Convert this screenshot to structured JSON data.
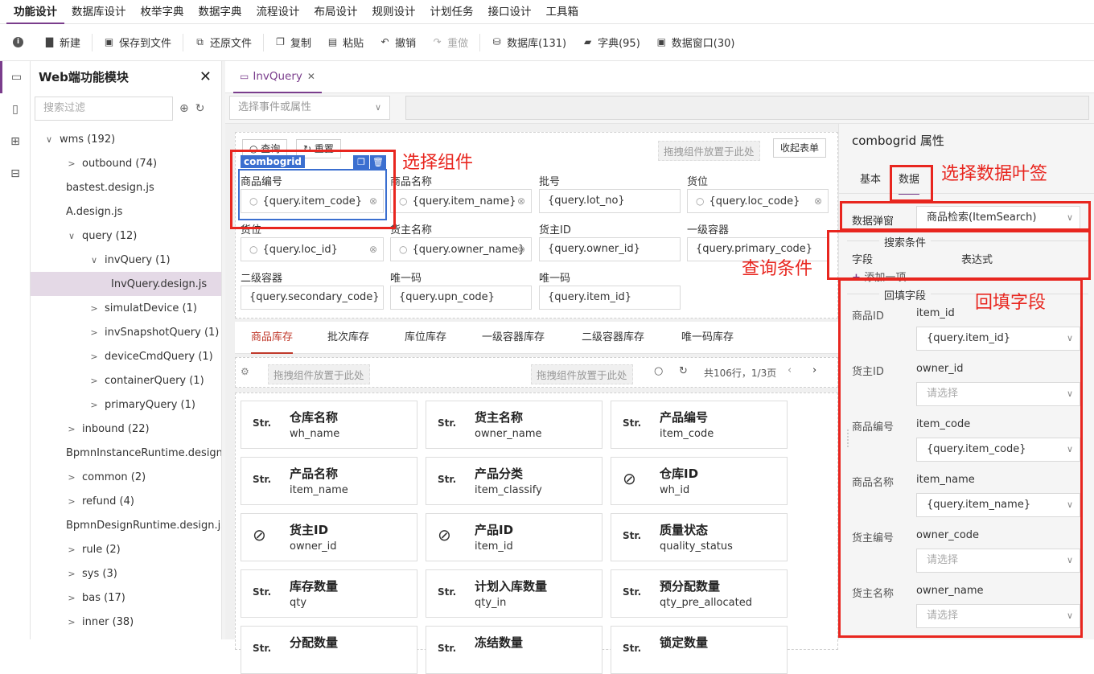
{
  "menu": [
    "功能设计",
    "数据库设计",
    "枚举字典",
    "数据字典",
    "流程设计",
    "布局设计",
    "规则设计",
    "计划任务",
    "接口设计",
    "工具箱"
  ],
  "toolbar": {
    "info": "",
    "new": "新建",
    "save": "保存到文件",
    "restore": "还原文件",
    "copy": "复制",
    "paste": "粘贴",
    "undo": "撤销",
    "redo": "重做",
    "db": "数据库(131)",
    "dict": "字典(95)",
    "window": "数据窗口(30)"
  },
  "tree": {
    "title": "Web端功能模块",
    "search_placeholder": "搜索过滤",
    "items": [
      {
        "label": "wms (192)",
        "level": 1,
        "arrow": "∨"
      },
      {
        "label": "outbound (74)",
        "level": 2,
        "arrow": ">"
      },
      {
        "label": "bastest.design.js",
        "level": 2,
        "arrow": ""
      },
      {
        "label": "A.design.js",
        "level": 2,
        "arrow": ""
      },
      {
        "label": "query (12)",
        "level": 2,
        "arrow": "∨"
      },
      {
        "label": "invQuery (1)",
        "level": 3,
        "arrow": "∨"
      },
      {
        "label": "InvQuery.design.js",
        "level": 4,
        "arrow": "",
        "selected": true
      },
      {
        "label": "simulatDevice (1)",
        "level": 3,
        "arrow": ">"
      },
      {
        "label": "invSnapshotQuery (1)",
        "level": 3,
        "arrow": ">"
      },
      {
        "label": "deviceCmdQuery (1)",
        "level": 3,
        "arrow": ">"
      },
      {
        "label": "containerQuery (1)",
        "level": 3,
        "arrow": ">"
      },
      {
        "label": "primaryQuery (1)",
        "level": 3,
        "arrow": ">"
      },
      {
        "label": "inbound (22)",
        "level": 2,
        "arrow": ">"
      },
      {
        "label": "BpmnInstanceRuntime.design.js",
        "level": 2,
        "arrow": ""
      },
      {
        "label": "common (2)",
        "level": 2,
        "arrow": ">"
      },
      {
        "label": "refund (4)",
        "level": 2,
        "arrow": ">"
      },
      {
        "label": "BpmnDesignRuntime.design.js",
        "level": 2,
        "arrow": ""
      },
      {
        "label": "rule (2)",
        "level": 2,
        "arrow": ">"
      },
      {
        "label": "sys (3)",
        "level": 2,
        "arrow": ">"
      },
      {
        "label": "bas (17)",
        "level": 2,
        "arrow": ">"
      },
      {
        "label": "inner (38)",
        "level": 2,
        "arrow": ">"
      }
    ]
  },
  "editor_tab": "InvQuery",
  "event_select_placeholder": "选择事件或属性",
  "form": {
    "query_btn": "查询",
    "reset_btn": "重置",
    "drop_hint": "拖拽组件放置于此处",
    "collapse_btn": "收起表单",
    "combo_tag": "combogrid",
    "fields": [
      {
        "label": "商品编号",
        "value": "{query.item_code}",
        "search": true
      },
      {
        "label": "商品名称",
        "value": "{query.item_name}",
        "search": true
      },
      {
        "label": "批号",
        "value": "{query.lot_no}",
        "search": false
      },
      {
        "label": "货位",
        "value": "{query.loc_code}",
        "search": true
      },
      {
        "label": "货位",
        "value": "{query.loc_id}",
        "search": true
      },
      {
        "label": "货主名称",
        "value": "{query.owner_name}",
        "search": true
      },
      {
        "label": "货主ID",
        "value": "{query.owner_id}",
        "search": false
      },
      {
        "label": "一级容器",
        "value": "{query.primary_code}",
        "search": false
      },
      {
        "label": "二级容器",
        "value": "{query.secondary_code}",
        "search": false
      },
      {
        "label": "唯一码",
        "value": "{query.upn_code}",
        "search": false
      },
      {
        "label": "唯一码",
        "value": "{query.item_id}",
        "search": false
      }
    ]
  },
  "sub_tabs": [
    "商品库存",
    "批次库存",
    "库位库存",
    "一级容器库存",
    "二级容器库存",
    "唯一码库存"
  ],
  "grid": {
    "drop_hint_left": "拖拽组件放置于此处",
    "drop_hint_right": "拖拽组件放置于此处",
    "page_info": "共106行，1/3页"
  },
  "columns": [
    {
      "type": "Str.",
      "cn": "仓库名称",
      "en": "wh_name"
    },
    {
      "type": "Str.",
      "cn": "货主名称",
      "en": "owner_name"
    },
    {
      "type": "Str.",
      "cn": "产品编号",
      "en": "item_code"
    },
    {
      "type": "Str.",
      "cn": "产品名称",
      "en": "item_name"
    },
    {
      "type": "Str.",
      "cn": "产品分类",
      "en": "item_classify"
    },
    {
      "type": "hidden",
      "cn": "仓库ID",
      "en": "wh_id"
    },
    {
      "type": "hidden",
      "cn": "货主ID",
      "en": "owner_id"
    },
    {
      "type": "hidden",
      "cn": "产品ID",
      "en": "item_id"
    },
    {
      "type": "Str.",
      "cn": "质量状态",
      "en": "quality_status"
    },
    {
      "type": "Str.",
      "cn": "库存数量",
      "en": "qty"
    },
    {
      "type": "Str.",
      "cn": "计划入库数量",
      "en": "qty_in"
    },
    {
      "type": "Str.",
      "cn": "预分配数量",
      "en": "qty_pre_allocated"
    },
    {
      "type": "Str.",
      "cn": "分配数量",
      "en": ""
    },
    {
      "type": "Str.",
      "cn": "冻结数量",
      "en": ""
    },
    {
      "type": "Str.",
      "cn": "锁定数量",
      "en": ""
    }
  ],
  "props": {
    "title": "combogrid 属性",
    "tab_basic": "基本",
    "tab_data": "数据",
    "popup_label": "数据弹窗",
    "popup_value": "商品检索(ItemSearch)",
    "search_legend": "搜索条件",
    "col_field": "字段",
    "col_expr": "表达式",
    "add_item": "添加一项",
    "fill_legend": "回填字段",
    "fill_fields": [
      {
        "label": "商品ID",
        "field": "item_id",
        "value": "{query.item_id}",
        "placeholder": false
      },
      {
        "label": "货主ID",
        "field": "owner_id",
        "value": "请选择",
        "placeholder": true
      },
      {
        "label": "商品编号",
        "field": "item_code",
        "value": "{query.item_code}",
        "placeholder": false
      },
      {
        "label": "商品名称",
        "field": "item_name",
        "value": "{query.item_name}",
        "placeholder": false
      },
      {
        "label": "货主编号",
        "field": "owner_code",
        "value": "请选择",
        "placeholder": true
      },
      {
        "label": "货主名称",
        "field": "owner_name",
        "value": "请选择",
        "placeholder": true
      }
    ]
  },
  "annotations": {
    "select_component": "选择组件",
    "select_data_tab": "选择数据叶签",
    "query_conditions": "查询条件",
    "fill_fields": "回填字段"
  }
}
